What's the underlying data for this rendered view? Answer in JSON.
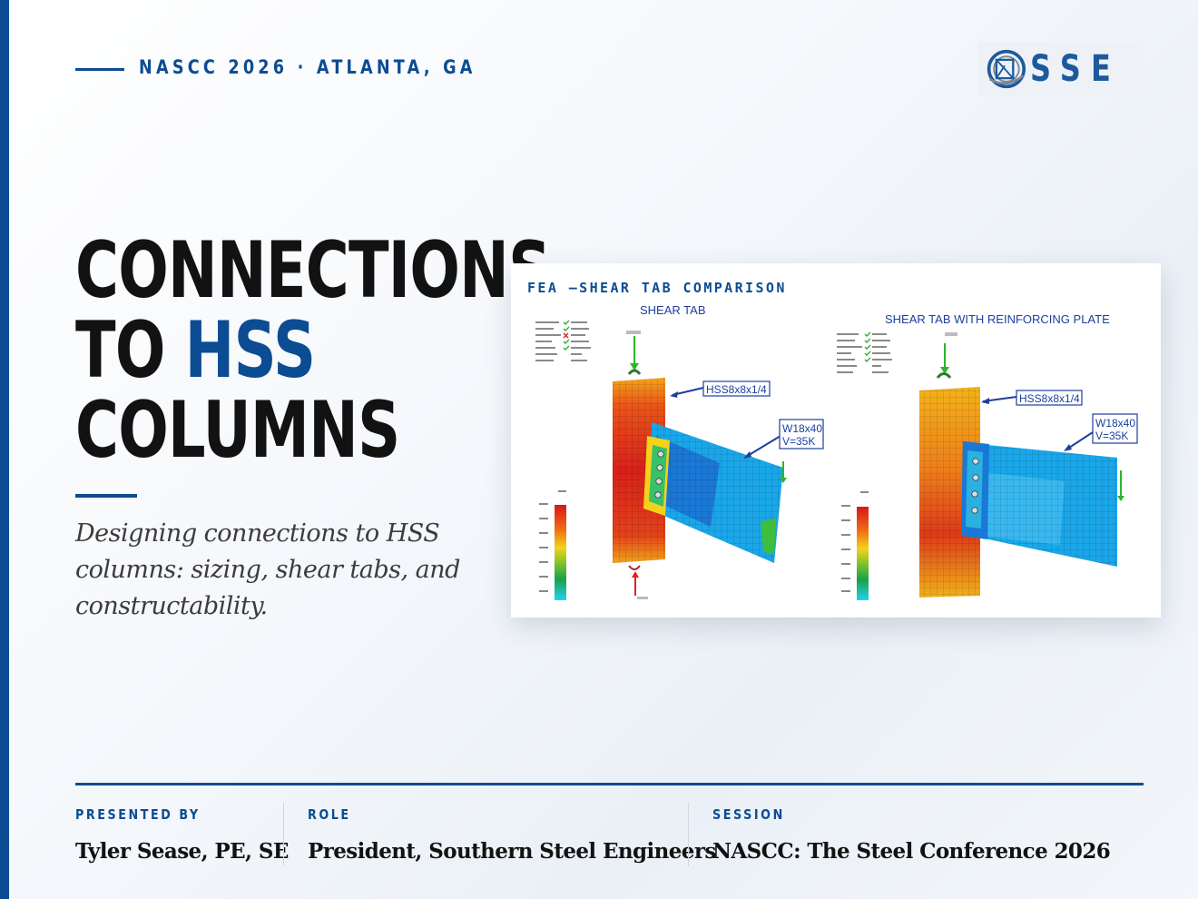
{
  "header": {
    "kicker": "NASCC 2026 · ATLANTA, GA",
    "logo_text": "SSE",
    "logo_icon": "hss-column-cross-section-icon"
  },
  "title": {
    "line1": "CONNECTIONS",
    "line2_prefix": "TO ",
    "line2_accent": "HSS",
    "line3": "COLUMNS"
  },
  "subtitle": "Designing connections to HSS columns: sizing, shear tabs, and constructability.",
  "figure": {
    "title": "FEA –SHEAR TAB COMPARISON",
    "left_label": "SHEAR TAB",
    "right_label": "SHEAR TAB WITH REINFORCING PLATE",
    "left_callouts": [
      "HSS8x8x1/4",
      "W18x40",
      "V=35K"
    ],
    "right_callouts": [
      "HSS8x8x1/4",
      "W18x40",
      "V=35K"
    ]
  },
  "footer": {
    "presented_by_label": "PRESENTED BY",
    "presented_by": "Tyler Sease, PE, SE",
    "role_label": "ROLE",
    "role": "President, Southern Steel Engineers",
    "session_label": "SESSION",
    "session": "NASCC: The Steel Conference 2026"
  },
  "colors": {
    "brand_blue": "#0c4c92",
    "title_dark": "#121212",
    "fea_red": "#d9221b",
    "fea_blue": "#1aa6e8"
  }
}
